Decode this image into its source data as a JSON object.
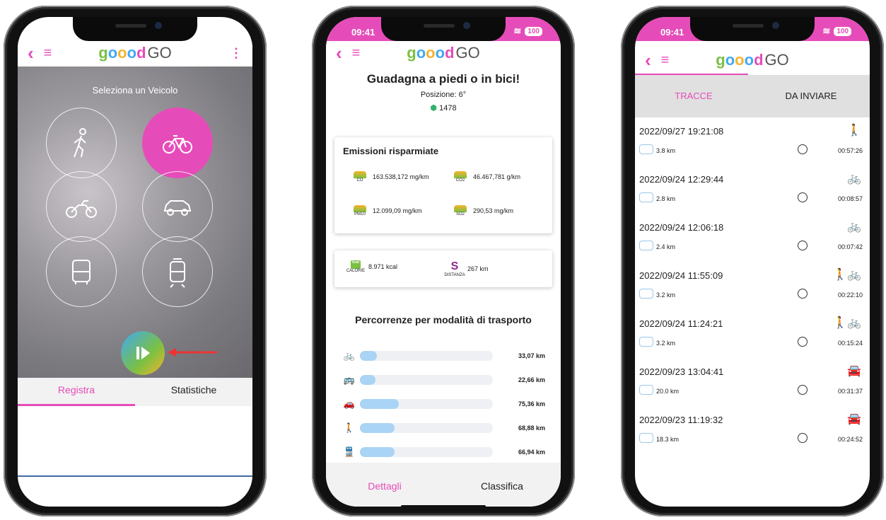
{
  "phone1": {
    "logo": {
      "g": "g",
      "o1": "o",
      "o2": "o",
      "o3": "o",
      "d": "d",
      "go": "GO"
    },
    "select_title": "Seleziona un Veicolo",
    "vehicles": [
      "walk",
      "bike",
      "motorbike",
      "car",
      "bus",
      "tram"
    ],
    "active_vehicle": "bike",
    "tabs": [
      "Registra",
      "Statistiche"
    ],
    "active_tab": "Registra"
  },
  "phone2": {
    "status_time": "09:41",
    "battery": "100",
    "title": "Guadagna a piedi o in bici!",
    "position": "Posizione: 6°",
    "points": "1478",
    "emissions_title": "Emissioni risparmiate",
    "emissions": [
      {
        "label": "CO",
        "value": "163.538,172 mg/km"
      },
      {
        "label": "CO2",
        "value": "46.467,781 g/km"
      },
      {
        "label": "PM10",
        "value": "12.099,09 mg/km"
      },
      {
        "label": "SO2",
        "value": "290,53 mg/km"
      }
    ],
    "calorie": {
      "label": "CALORIE",
      "value": "8.971 kcal",
      "icon_text": "kcal"
    },
    "distanza": {
      "label": "DISTANZA",
      "value": "267 km"
    },
    "perc_title": "Percorrenze per modalità di trasporto",
    "modes": [
      {
        "icon": "bike-icon",
        "value": "33,07 km",
        "fraction": 0.13
      },
      {
        "icon": "bus-icon",
        "value": "22,66 km",
        "fraction": 0.09
      },
      {
        "icon": "car-icon",
        "value": "75,36 km",
        "fraction": 0.29
      },
      {
        "icon": "walk-icon",
        "value": "68,88 km",
        "fraction": 0.26
      },
      {
        "icon": "train-icon",
        "value": "66,94 km",
        "fraction": 0.26
      }
    ],
    "tabs": [
      "Dettagli",
      "Classifica"
    ],
    "active_tab": "Dettagli"
  },
  "phone3": {
    "status_time": "09:41",
    "battery": "100",
    "tabs": [
      "TRACCE",
      "DA INVIARE"
    ],
    "active_tab": "TRACCE",
    "tracks": [
      {
        "date": "2022/09/27 19:21:08",
        "modes": "🚶",
        "km": "3.8 km",
        "dur": "00:57:26"
      },
      {
        "date": "2022/09/24 12:29:44",
        "modes": "🚲",
        "km": "2.8 km",
        "dur": "00:08:57"
      },
      {
        "date": "2022/09/24 12:06:18",
        "modes": "🚲",
        "km": "2.4 km",
        "dur": "00:07:42"
      },
      {
        "date": "2022/09/24 11:55:09",
        "modes": "🚶🚲",
        "km": "3.2 km",
        "dur": "00:22:10"
      },
      {
        "date": "2022/09/24 11:24:21",
        "modes": "🚶🚲",
        "km": "3.2 km",
        "dur": "00:15:24"
      },
      {
        "date": "2022/09/23 13:04:41",
        "modes": "🚘",
        "km": "20.0 km",
        "dur": "00:31:37"
      },
      {
        "date": "2022/09/23 11:19:32",
        "modes": "🚘",
        "km": "18.3 km",
        "dur": "00:24:52"
      }
    ]
  },
  "colors": {
    "accent": "#e64cb9",
    "green": "#7bc043",
    "blue": "#3fa9f5"
  }
}
